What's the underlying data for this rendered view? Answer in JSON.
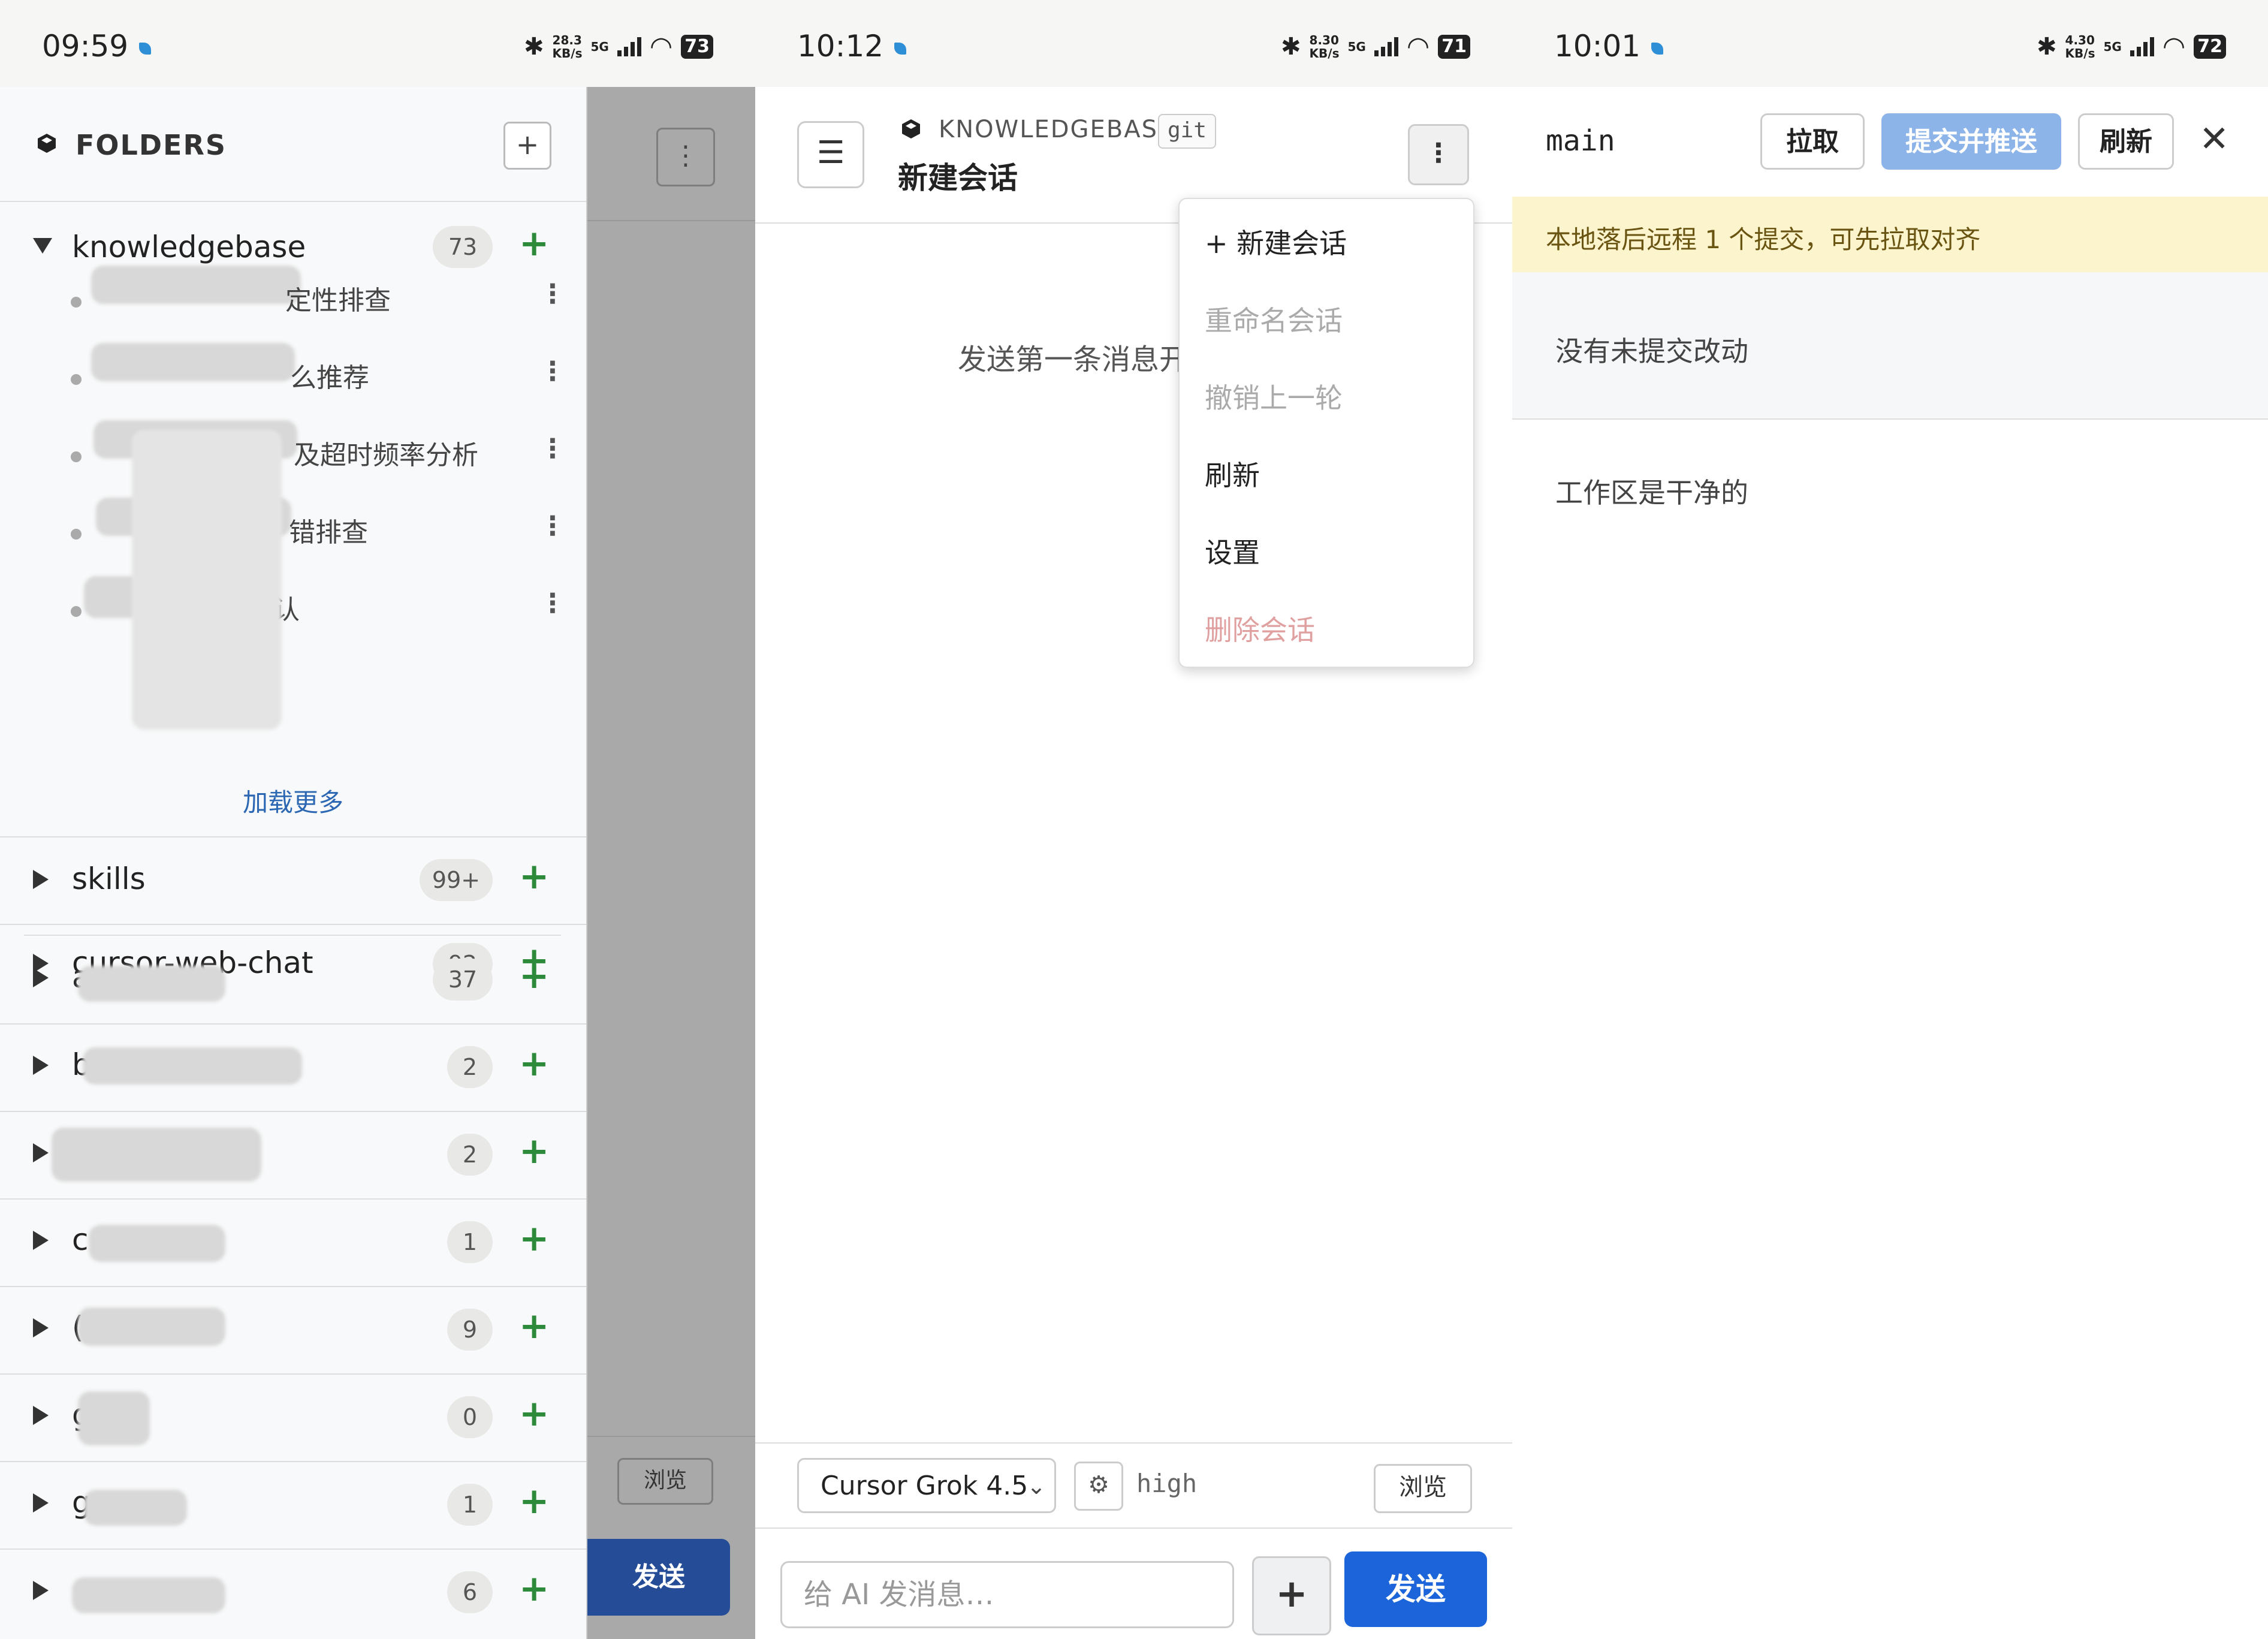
{
  "screen1": {
    "status": {
      "time": "09:59",
      "speed": [
        "28.3",
        "KB/s"
      ],
      "net": "5G",
      "battery": "73"
    },
    "drawer": {
      "title": "FOLDERS",
      "add_label": "+",
      "expanded": {
        "name": "knowledgebase",
        "count": "73",
        "conversations": [
          {
            "label": "定性排查"
          },
          {
            "label": "么推荐"
          },
          {
            "label": "及超时频率分析"
          },
          {
            "label": "错排查"
          },
          {
            "label": "确认"
          }
        ],
        "load_more": "加载更多"
      },
      "folders": [
        {
          "name": "skills",
          "count": "99+"
        },
        {
          "name": "cursor-web-chat",
          "count": "92"
        },
        {
          "name": "a",
          "count": "37"
        },
        {
          "name": "b",
          "count": "2"
        },
        {
          "name": "",
          "count": "2"
        },
        {
          "name": "c",
          "count": "1"
        },
        {
          "name": "(",
          "count": "9"
        },
        {
          "name": "g",
          "count": "0"
        },
        {
          "name": "g",
          "count": "1"
        },
        {
          "name": "",
          "count": "6"
        }
      ]
    },
    "behind": {
      "menu": "⋮",
      "browse": "浏览",
      "send": "发送"
    }
  },
  "screen2": {
    "status": {
      "time": "10:12",
      "speed": [
        "8.30",
        "KB/s"
      ],
      "net": "5G",
      "battery": "71"
    },
    "header": {
      "project": "KNOWLEDGEBASE",
      "badge": "git",
      "title": "新建会话",
      "menu_icon": "☰",
      "kebab": "⋮"
    },
    "empty_hint": "发送第一条消息开",
    "menu": {
      "new": "+ 新建会话",
      "rename": "重命名会话",
      "undo": "撤销上一轮",
      "refresh": "刷新",
      "settings": "设置",
      "delete": "删除会话"
    },
    "composer": {
      "model": "Cursor Grok 4.5",
      "effort": "high",
      "browse": "浏览",
      "placeholder": "给 AI 发消息…",
      "plus": "+",
      "send": "发送"
    }
  },
  "screen3": {
    "status": {
      "time": "10:01",
      "speed": [
        "4.30",
        "KB/s"
      ],
      "net": "5G",
      "battery": "72"
    },
    "branch": "main",
    "buttons": {
      "pull": "拉取",
      "commit_push": "提交并推送",
      "refresh": "刷新",
      "close": "✕"
    },
    "warning": "本地落后远程 1 个提交，可先拉取对齐",
    "no_changes": "没有未提交改动",
    "clean": "工作区是干净的"
  },
  "colors": {
    "accent": "#1b64da",
    "add_green": "#2d8a3a",
    "warning_bg": "#fcf4cc",
    "link": "#2c67b3",
    "danger_disabled": "#e0a0a0"
  }
}
